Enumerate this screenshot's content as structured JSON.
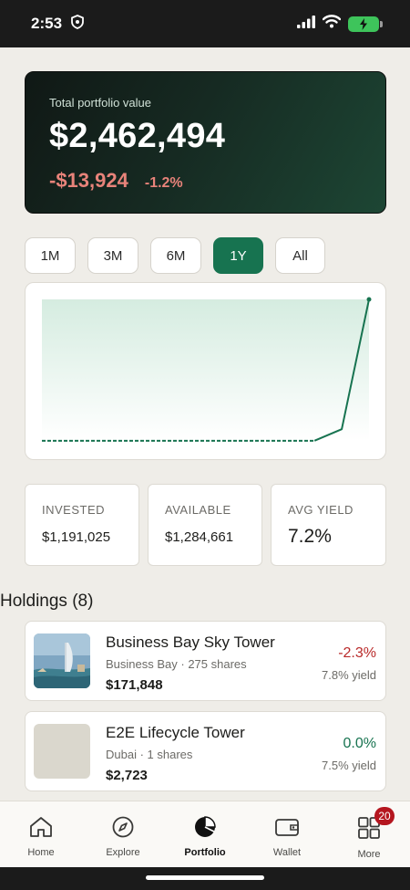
{
  "status_bar": {
    "time": "2:53"
  },
  "portfolio": {
    "label": "Total portfolio value",
    "value": "$2,462,494",
    "change_amount": "-$13,924",
    "change_percent": "-1.2%",
    "negative_color": "#e8837a"
  },
  "ranges": {
    "items": [
      "1M",
      "3M",
      "6M",
      "1Y",
      "All"
    ],
    "selected": "1Y"
  },
  "chart_data": {
    "type": "area",
    "x": [
      0,
      1,
      2,
      3,
      4,
      5,
      6,
      7,
      8,
      9,
      10,
      11,
      12
    ],
    "values": [
      0.02,
      0.02,
      0.02,
      0.02,
      0.02,
      0.02,
      0.02,
      0.02,
      0.02,
      0.02,
      0.02,
      0.1,
      1.0
    ],
    "grid": false,
    "line_color": "#177350",
    "fill_color": "#d9eee4"
  },
  "stats": {
    "invested": {
      "label": "INVESTED",
      "value": "$1,191,025"
    },
    "available": {
      "label": "AVAILABLE",
      "value": "$1,284,661"
    },
    "avg_yield": {
      "label": "AVG YIELD",
      "value": "7.2%"
    }
  },
  "holdings": {
    "title": "Holdings (8)",
    "items": [
      {
        "name": "Business Bay Sky Tower",
        "subtitle": "Business Bay · 275 shares",
        "amount": "$171,848",
        "change": "-2.3%",
        "yield": "7.8% yield",
        "thumb": "photo"
      },
      {
        "name": "E2E Lifecycle Tower",
        "subtitle": "Dubai · 1 shares",
        "amount": "$2,723",
        "change": "0.0%",
        "yield": "7.5% yield",
        "thumb": "placeholder"
      }
    ]
  },
  "nav": {
    "items": [
      {
        "label": "Home",
        "icon": "home-icon"
      },
      {
        "label": "Explore",
        "icon": "compass-icon"
      },
      {
        "label": "Portfolio",
        "icon": "pie-chart-icon"
      },
      {
        "label": "Wallet",
        "icon": "wallet-icon"
      },
      {
        "label": "More",
        "icon": "grid-icon",
        "badge": "20"
      }
    ],
    "active": "Portfolio"
  },
  "colors": {
    "accent": "#177350",
    "negative": "#b92a2a",
    "background": "#efede8"
  }
}
